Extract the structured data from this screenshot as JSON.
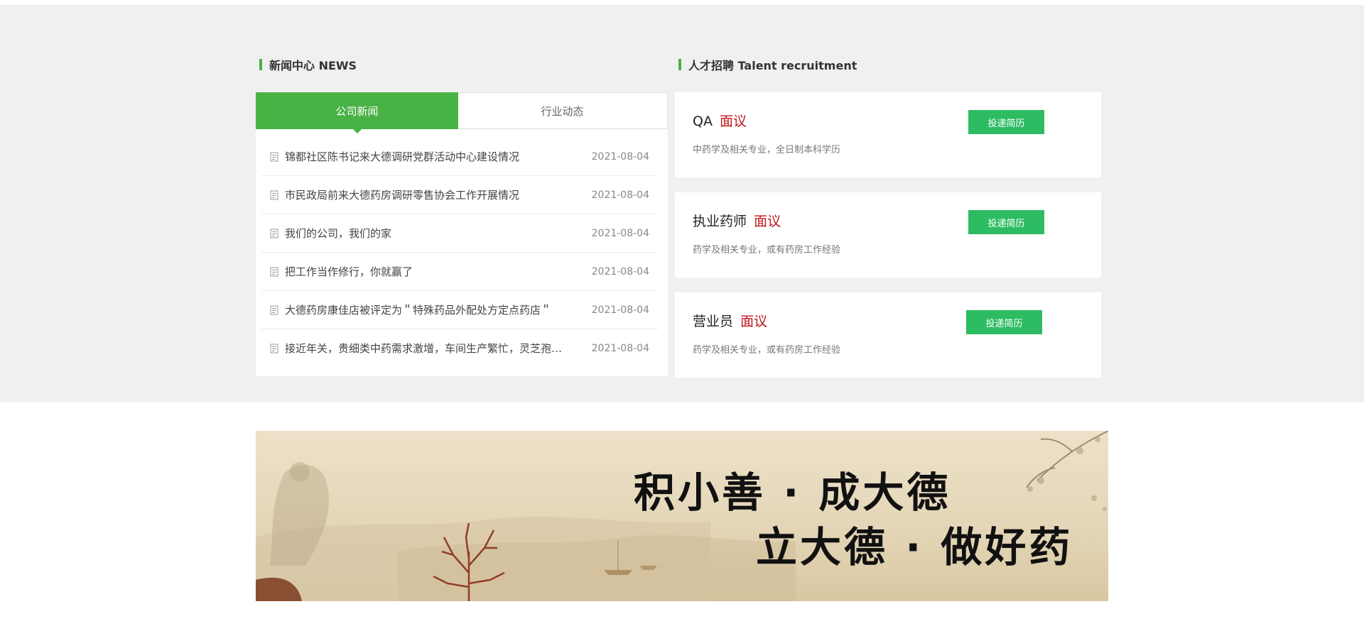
{
  "news": {
    "title": "新闻中心 NEWS",
    "tabs": [
      {
        "label": "公司新闻",
        "active": true
      },
      {
        "label": "行业动态",
        "active": false
      }
    ],
    "items": [
      {
        "title": "锦都社区陈书记来大德调研党群活动中心建设情况",
        "date": "2021-08-04"
      },
      {
        "title": "市民政局前来大德药房调研零售协会工作开展情况",
        "date": "2021-08-04"
      },
      {
        "title": "我们的公司，我们的家",
        "date": "2021-08-04"
      },
      {
        "title": "把工作当作修行，你就赢了",
        "date": "2021-08-04"
      },
      {
        "title": "大德药房康佳店被评定为＂特殊药品外配处方定点药店＂",
        "date": "2021-08-04"
      },
      {
        "title": "接近年关，贵细类中药需求激增，车间生产繁忙，灵芝孢子粉…",
        "date": "2021-08-04"
      }
    ]
  },
  "jobs": {
    "title": "人才招聘 Talent recruitment",
    "items": [
      {
        "name": "QA",
        "salary": "面议",
        "desc": "中药学及相关专业，全日制本科学历",
        "button": "投递简历"
      },
      {
        "name": "执业药师",
        "salary": "面议",
        "desc": "药学及相关专业，或有药房工作经验",
        "button": "投递简历"
      },
      {
        "name": "营业员",
        "salary": "面议",
        "desc": "药学及相关专业，或有药房工作经验",
        "button": "投递简历"
      }
    ]
  },
  "banner": {
    "line1": "积小善 · 成大德",
    "line2": "立大德 · 做好药"
  },
  "colors": {
    "accent_green": "#49b245",
    "button_green": "#2ebc63",
    "salary_red": "#c0161c",
    "band_gray": "#f0f0f0"
  }
}
